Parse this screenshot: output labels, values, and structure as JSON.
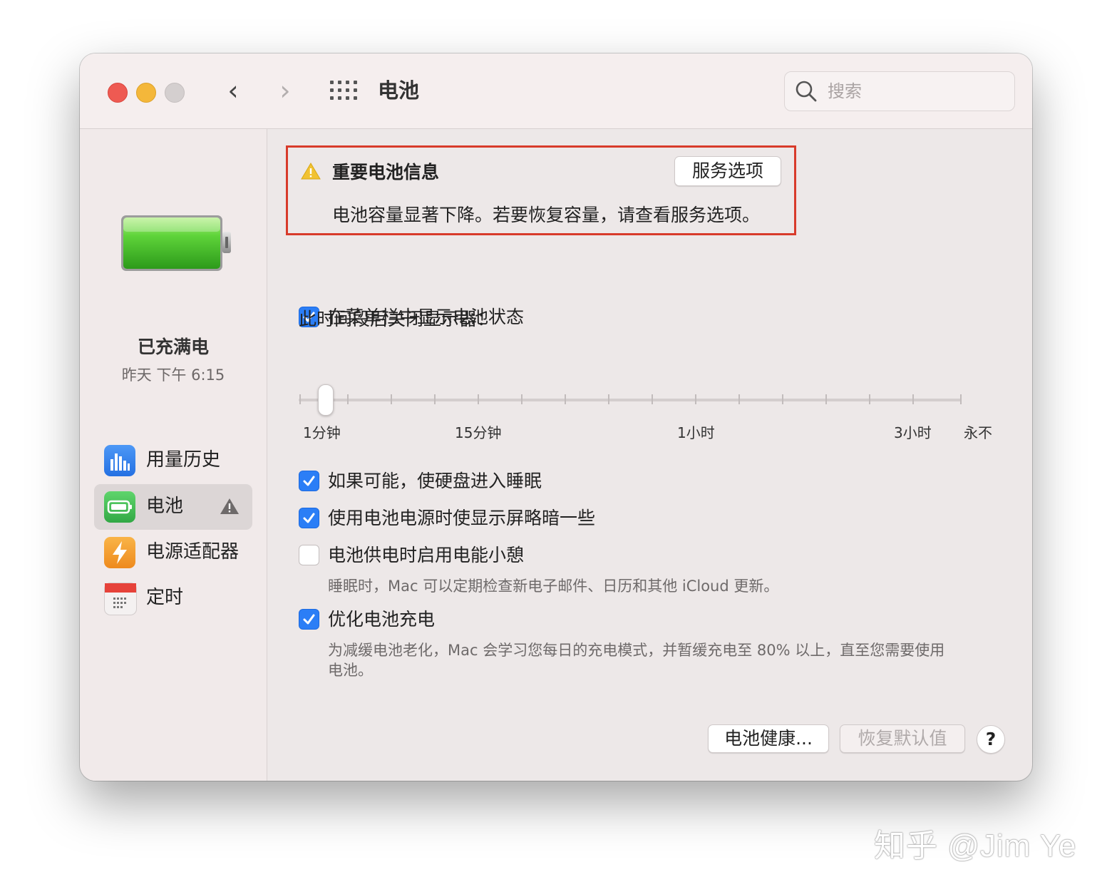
{
  "window": {
    "title": "电池",
    "search": {
      "placeholder": "搜索",
      "value": ""
    }
  },
  "sidebar": {
    "status_title": "已充满电",
    "status_time": "昨天 下午 6:15",
    "items": [
      {
        "label": "用量历史",
        "icon": "bar-chart-icon",
        "color": "#3a85f2"
      },
      {
        "label": "电池",
        "icon": "battery-icon",
        "color": "#4cc15c",
        "active": true,
        "warning": true
      },
      {
        "label": "电源适配器",
        "icon": "lightning-icon",
        "color": "#f5a030"
      },
      {
        "label": "定时",
        "icon": "calendar-icon",
        "color": "#e6423a"
      }
    ]
  },
  "alert": {
    "title": "重要电池信息",
    "description": "电池容量显著下降。若要恢复容量，请查看服务选项。",
    "button_label": "服务选项",
    "border_color": "#d83b2b"
  },
  "options": {
    "show_in_menubar": {
      "label": "在菜单栏中显示电池状态",
      "checked": true
    },
    "sleep_disks": {
      "label": "如果可能，使硬盘进入睡眠",
      "checked": true
    },
    "dim_display": {
      "label": "使用电池电源时使显示屏略暗一些",
      "checked": true
    },
    "power_nap": {
      "label": "电池供电时启用电能小憩",
      "checked": false,
      "description": "睡眠时，Mac 可以定期检查新电子邮件、日历和其他 iCloud 更新。"
    },
    "optimized_charging": {
      "label": "优化电池充电",
      "checked": true,
      "description_line1": "为减缓电池老化，Mac 会学习您每日的充电模式，并暂缓充电至 80% 以上，直至您需要使用",
      "description_line2": "电池。"
    }
  },
  "display_sleep": {
    "label": "此时间段后关闭显示器：",
    "value": "2分钟",
    "ticks": [
      "1分钟",
      "15分钟",
      "1小时",
      "3小时",
      "永不"
    ]
  },
  "footer": {
    "battery_health_label": "电池健康...",
    "restore_defaults_label": "恢复默认值",
    "help_label": "?"
  },
  "watermark": "知乎 @Jim Ye",
  "colors": {
    "accent": "#2b7ef6",
    "warning": "#f1c232"
  }
}
